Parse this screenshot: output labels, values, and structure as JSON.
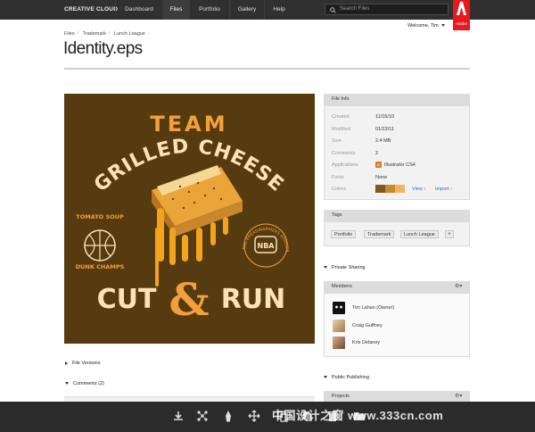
{
  "nav": {
    "brand": "CREATIVE CLOUD",
    "items": [
      "Dashboard",
      "Files",
      "Portfolio",
      "Gallery",
      "Help"
    ],
    "active": "Files",
    "search_placeholder": "Search Files",
    "adobe_label": "Adobe"
  },
  "header": {
    "breadcrumbs": [
      "Files",
      "Trademark",
      "Lunch League"
    ],
    "welcome": "Welcome, Tim",
    "title": "Identity.eps"
  },
  "artwork": {
    "line1": "TEAM",
    "line2": "GRILLED CHEESE",
    "left_top": "TOMATO SOUP",
    "left_bottom": "DUNK CHAMPS",
    "badge": "NBA",
    "badge_ring": "NATIONAL BREADWARMERS ASSOCIATION",
    "line3_a": "CUT",
    "line3_amp": "&",
    "line3_b": "RUN"
  },
  "file_info": {
    "header": "File Info",
    "rows": [
      {
        "label": "Created",
        "value": "11/15/10"
      },
      {
        "label": "Modified",
        "value": "01/22/11"
      },
      {
        "label": "Size",
        "value": "2.4 MB"
      },
      {
        "label": "Comments",
        "value": "2"
      },
      {
        "label": "Applications",
        "value": "Illustrator CS4"
      },
      {
        "label": "Fonts",
        "value": "None"
      },
      {
        "label": "Colors",
        "value": ""
      }
    ],
    "app_icon": "Ai",
    "colors": [
      "#7a5a1e",
      "#c58a2c",
      "#f0b75a",
      "#f7c98a"
    ],
    "view_link": "View",
    "import_link": "Import"
  },
  "tags": {
    "header": "Tags",
    "items": [
      "Portfolio",
      "Trademark",
      "Lunch League"
    ],
    "add": "+"
  },
  "private_sharing": {
    "label": "Private Sharing",
    "members_header": "Members",
    "members": [
      {
        "name": "Tim Lahan (Owner)"
      },
      {
        "name": "Craig Guffney"
      },
      {
        "name": "Kris Delaney"
      }
    ]
  },
  "public_publishing": {
    "label": "Public Publishing",
    "projects_header": "Projects"
  },
  "left_sections": {
    "file_versions": "File Versions",
    "comments": "Comments (2)"
  },
  "watermark": "中国设计之窗 www.333cn.com",
  "icons": [
    "download-icon",
    "share-icon",
    "pen-icon",
    "move-icon",
    "copy-icon",
    "delete-icon",
    "folder-icon"
  ]
}
